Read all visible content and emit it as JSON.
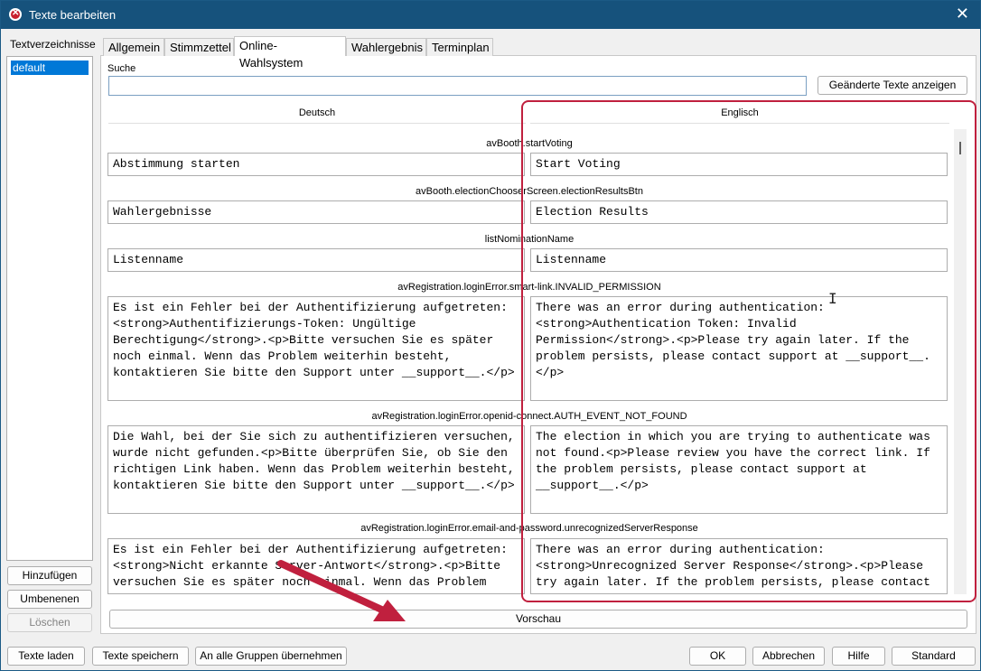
{
  "window": {
    "title": "Texte bearbeiten",
    "close_glyph": "✕"
  },
  "left": {
    "label": "Textverzeichnisse",
    "items": [
      {
        "label": "default",
        "selected": true
      }
    ],
    "add_label": "Hinzufügen",
    "rename_label": "Umbenenen",
    "delete_label": "Löschen"
  },
  "tabs": [
    {
      "label": "Allgemein"
    },
    {
      "label": "Stimmzettel"
    },
    {
      "label": "Online-Wahlsystem",
      "active": true
    },
    {
      "label": "Wahlergebnis"
    },
    {
      "label": "Terminplan"
    }
  ],
  "search": {
    "label": "Suche",
    "value": ""
  },
  "changed_texts_label": "Geänderte Texte anzeigen",
  "columns": {
    "german": "Deutsch",
    "english": "Englisch"
  },
  "entries": [
    {
      "key": "avBooth.startVoting",
      "de": "Abstimmung starten",
      "en": "Start Voting"
    },
    {
      "key": "avBooth.electionChooserScreen.electionResultsBtn",
      "de": "Wahlergebnisse",
      "en": "Election Results"
    },
    {
      "key": "listNominationName",
      "de": "Listenname",
      "en": "Listenname"
    },
    {
      "key": "avRegistration.loginError.smart-link.INVALID_PERMISSION",
      "de": "Es ist ein Fehler bei der Authentifizierung aufgetreten: <strong>Authentifizierungs-Token: Ungültige Berechtigung</strong>.<p>Bitte versuchen Sie es später noch einmal. Wenn das Problem weiterhin besteht, kontaktieren Sie bitte den Support unter __support__.</p>",
      "en": "There was an error during authentication: <strong>Authentication Token: Invalid Permission</strong>.<p>Please try again later. If the problem persists, please contact support at __support__.</p>"
    },
    {
      "key": "avRegistration.loginError.openid-connect.AUTH_EVENT_NOT_FOUND",
      "de": "Die Wahl, bei der Sie sich zu authentifizieren versuchen, wurde nicht gefunden.<p>Bitte überprüfen Sie, ob Sie den richtigen Link haben. Wenn das Problem weiterhin besteht, kontaktieren Sie bitte den Support unter __support__.</p>",
      "en": "The election in which you are trying to authenticate was not found.<p>Please review you have the correct link. If the problem persists, please contact support at __support__.</p>"
    },
    {
      "key": "avRegistration.loginError.email-and-password.unrecognizedServerResponse",
      "de": "Es ist ein Fehler bei der Authentifizierung aufgetreten: <strong>Nicht erkannte Server-Antwort</strong>.<p>Bitte versuchen Sie es später noch einmal. Wenn das Problem",
      "en": "There was an error during authentication: <strong>Unrecognized Server Response</strong>.<p>Please try again later. If the problem persists, please contact"
    }
  ],
  "preview_label": "Vorschau",
  "footer": {
    "load_label": "Texte laden",
    "save_label": "Texte speichern",
    "apply_all_label": "An alle Gruppen übernehmen",
    "ok_label": "OK",
    "cancel_label": "Abbrechen",
    "help_label": "Hilfe",
    "default_label": "Standard"
  },
  "annotation": {
    "highlight_color": "#c0203e"
  }
}
